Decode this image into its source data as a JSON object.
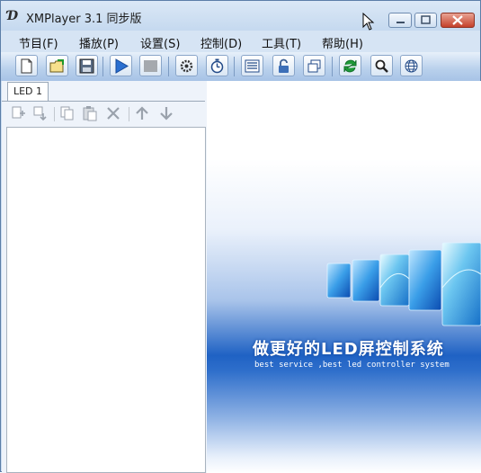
{
  "window": {
    "title": "XMPlayer 3.1 同步版"
  },
  "menu": [
    "节目(F)",
    "播放(P)",
    "设置(S)",
    "控制(D)",
    "工具(T)",
    "帮助(H)"
  ],
  "toolbar_icons": [
    "new-document-icon",
    "open-folder-icon",
    "save-icon",
    "play-icon",
    "stop-icon",
    "settings-gear-icon",
    "timer-icon",
    "screen-list-icon",
    "lock-icon",
    "windows-icon",
    "refresh-icon",
    "zoom-icon",
    "network-globe-icon"
  ],
  "tabs": [
    {
      "label": "LED 1"
    }
  ],
  "program_toolbar_icons": [
    "add-program-icon",
    "add-area-icon",
    "copy-icon",
    "paste-icon",
    "delete-icon",
    "move-up-icon",
    "move-down-icon"
  ],
  "splash": {
    "slogan": "做更好的LED屏控制系统",
    "slogan_en": "best service ,best led controller system"
  },
  "colors": {
    "accent": "#1f62c4",
    "close_button": "#c4402a"
  }
}
